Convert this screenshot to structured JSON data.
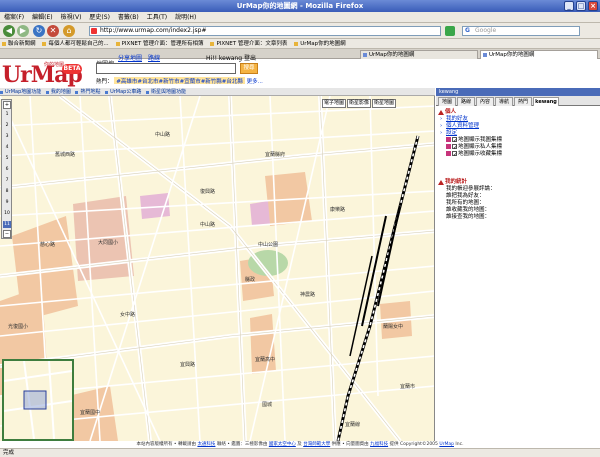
{
  "window": {
    "title": "UrMap你的地圖網 - Mozilla Firefox"
  },
  "menu": [
    "檔案(F)",
    "編輯(E)",
    "檢視(V)",
    "歷史(S)",
    "書籤(B)",
    "工具(T)",
    "說明(H)"
  ],
  "address": {
    "url": "http://www.urmap.com/index2.jsp#",
    "search_placeholder": "Google"
  },
  "bookmarks": [
    "聯合新聞網",
    "每個人都可輕鬆自己的...",
    "PIXNET 管理介面：管理所有相簿",
    "PIXNET 管理介面：文章列表",
    "UrMap你的地圖網"
  ],
  "tabs": [
    {
      "label": "UrMap你的地圖網",
      "active": false
    },
    {
      "label": "UrMap你的地圖網",
      "active": true
    }
  ],
  "header": {
    "logo_text": "UrMap",
    "logo_sub": "你的地圖",
    "beta": "BETA",
    "tab_search_map": "地圖搜",
    "tab_share_map": "分享地圖",
    "tab_route": "路線",
    "greeting": "Hi!! kewang 登出",
    "search_button": "搜尋",
    "hot_label": "熱門：",
    "hot_links": "#高雄市#台北市#新竹市#宜蘭市#新竹縣#台北縣",
    "hot_tail": "更多..."
  },
  "map_toolbar": [
    "UrMap地圖功能",
    "我的地圖",
    "熱門地點",
    "UrMap公車路",
    "電子地圖",
    "衛星與地圖功能"
  ],
  "map_types": [
    "電子地圖",
    "衛星影像",
    "衛星地圖"
  ],
  "zoom_labels": [
    "1",
    "2",
    "3",
    "4",
    "5",
    "6",
    "7",
    "8",
    "9",
    "10",
    "11"
  ],
  "map_labels": [
    "宜蘭縣府",
    "中山公園",
    "宜蘭市",
    "大同國小",
    "光復國小",
    "宜蘭國中",
    "蘭陽女中",
    "慈心路",
    "中山路",
    "復興路",
    "神農路",
    "女中路",
    "宜興路",
    "康樂路",
    "舊城西路",
    "宜蘭線",
    "宜蘭高中",
    "縣政",
    "國城",
    "中山路"
  ],
  "panel": {
    "title": "kewang",
    "tabs": [
      "地圖",
      "路線",
      "內容",
      "導航",
      "熱門",
      "kewang"
    ],
    "personal_header": "個人",
    "personal_links": [
      "我的好友",
      "個人資料管理",
      "設定"
    ],
    "display_options": [
      "地圖顯示我圖集標",
      "地圖顯示私人集標",
      "地圖顯示收藏集標"
    ],
    "stats_header": "我的統計",
    "stats": [
      "我的帳迎參展評論：",
      "誰把我為好友：",
      "我所有的地圖：",
      "誰收藏我的地圖：",
      "誰接查我的地圖："
    ]
  },
  "footer": {
    "text1": "本站內容版權所有 • 轉載請由",
    "link1": "太通科技",
    "text2": "聯絡 • 鑑圖：三極影像由",
    "link2": "國家太空中心",
    "text3": "及",
    "link3": "台灣師範大學",
    "text4": "供應 • 向量圖資由",
    "link4": "九福科技",
    "text5": "提供 Copyright©2005",
    "link5": "UrMap",
    "text6": "Inc."
  },
  "status": "完成",
  "colors": {
    "accent": "#4a6bb8",
    "brand_red": "#c51f2a",
    "brand_blue": "#2a68c4",
    "map_bg": "#fbf5da"
  }
}
